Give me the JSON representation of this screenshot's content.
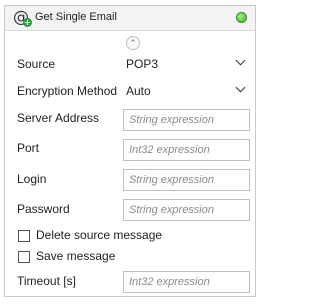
{
  "header": {
    "title": "Get Single Email",
    "icon": "at-sign-plus-icon",
    "status_color": "#3fb02a"
  },
  "fields": {
    "source": {
      "label": "Source",
      "value": "POP3"
    },
    "encryption": {
      "label": "Encryption Method",
      "value": "Auto"
    },
    "server_address": {
      "label": "Server Address",
      "placeholder": "String expression"
    },
    "port": {
      "label": "Port",
      "placeholder": "Int32 expression"
    },
    "login": {
      "label": "Login",
      "placeholder": "String expression"
    },
    "password": {
      "label": "Password",
      "placeholder": "String expression"
    },
    "delete_source": {
      "label": "Delete source message",
      "checked": false
    },
    "save_message": {
      "label": "Save message",
      "checked": false
    },
    "timeout": {
      "label": "Timeout [s]",
      "placeholder": "Int32 expression"
    }
  }
}
